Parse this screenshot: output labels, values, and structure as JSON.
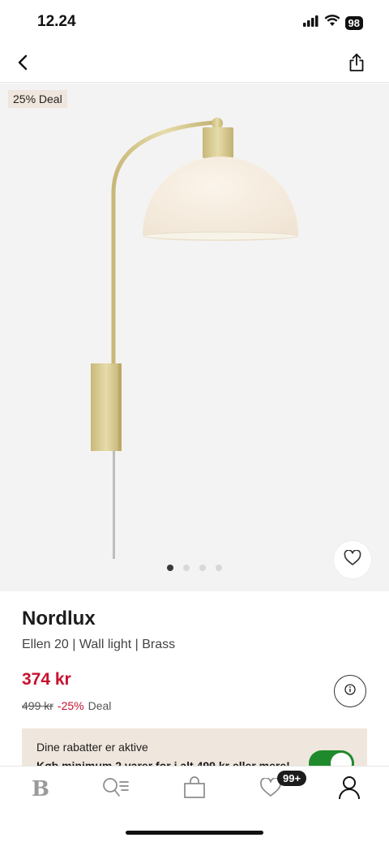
{
  "status": {
    "time": "12.24",
    "battery": "98"
  },
  "gallery": {
    "deal_badge": "25% Deal",
    "image_count": 4,
    "active_index": 0
  },
  "product": {
    "brand": "Nordlux",
    "name": "Ellen 20 | Wall light | Brass",
    "price": "374 kr",
    "old_price": "499 kr",
    "discount": "-25%",
    "deal_label": "Deal"
  },
  "promo": {
    "title": "Dine rabatter er aktive",
    "subtitle": "Køb minimum 2 varer for i alt 499 kr eller mere!",
    "toggle_on": true
  },
  "tabbar": {
    "items": [
      {
        "icon": "brand-logo-icon",
        "label": "B"
      },
      {
        "icon": "search-list-icon"
      },
      {
        "icon": "shopping-bag-icon"
      },
      {
        "icon": "heart-icon"
      },
      {
        "icon": "profile-icon"
      }
    ],
    "favorites_badge": "99+"
  },
  "colors": {
    "sale_red": "#c8102e",
    "badge_bg": "#efe6dd",
    "toggle_green": "#1f8a2b",
    "brass": "#d8c98f"
  }
}
